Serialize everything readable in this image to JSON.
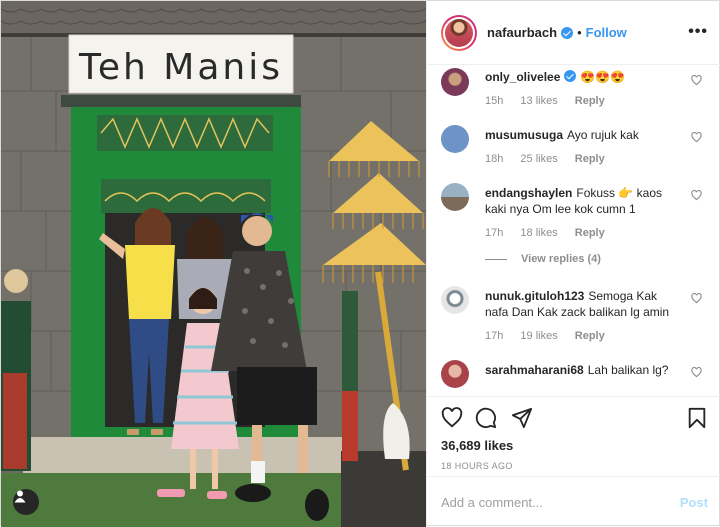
{
  "post": {
    "username": "nafaurbach",
    "follow_label": "Follow",
    "dot": "•",
    "more_label": "•••",
    "sign_text": "Teh Manis",
    "likes": "36,689 likes",
    "time_ago": "18 HOURS AGO",
    "comment_placeholder": "Add a comment...",
    "post_label": "Post"
  },
  "comments": [
    {
      "user": "only_olivelee",
      "text": "😍😍😍",
      "time": "15h",
      "likes": "13 likes",
      "reply": "Reply",
      "verified": true
    },
    {
      "user": "musumusuga",
      "text": "Ayo rujuk kak",
      "time": "18h",
      "likes": "25 likes",
      "reply": "Reply"
    },
    {
      "user": "endangshaylen",
      "text": "Fokuss 👉 kaos kaki nya Om lee kok cumn 1",
      "time": "17h",
      "likes": "18 likes",
      "reply": "Reply"
    },
    {
      "user": "nunuk.gituloh123",
      "text": "Semoga Kak nafa Dan Kak zack balikan lg amin",
      "time": "17h",
      "likes": "19 likes",
      "reply": "Reply"
    },
    {
      "user": "sarahmaharani68",
      "text": "Lah balikan lg?"
    }
  ],
  "view_replies": "View replies (4)",
  "colors": {
    "accent": "#3897f0",
    "post_disabled": "#b2dffc",
    "meta": "#8e8e8e"
  },
  "icons": [
    "heart-icon",
    "comment-icon",
    "share-icon",
    "bookmark-icon",
    "user-tag-icon",
    "verified-badge-icon"
  ]
}
